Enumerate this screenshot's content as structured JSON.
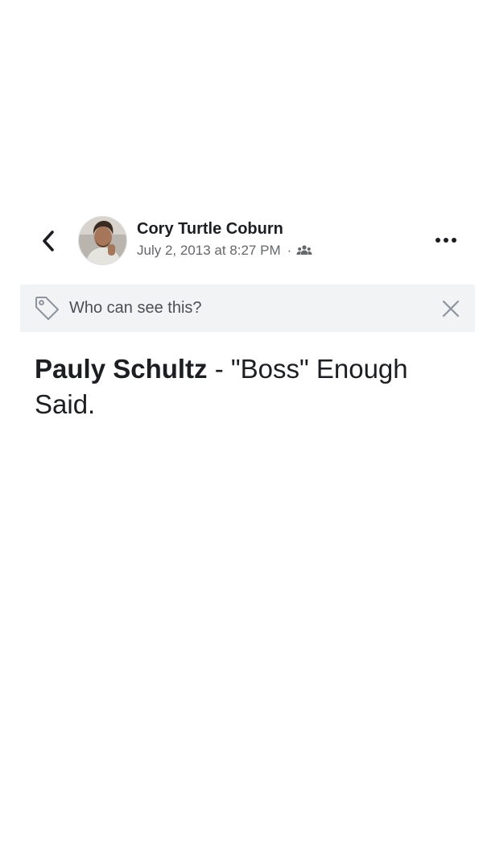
{
  "header": {
    "author_name": "Cory Turtle Coburn",
    "timestamp": "July 2, 2013 at 8:27 PM",
    "separator": "·",
    "audience_icon": "friends-icon",
    "back_icon": "chevron-left-icon",
    "more_icon": "more-dots-icon",
    "avatar_icon": "avatar-photo"
  },
  "privacy_banner": {
    "icon": "tag-icon",
    "text": "Who can see this?",
    "close_icon": "close-icon"
  },
  "post": {
    "tagged_name": "Pauly Schultz",
    "text": " - \"Boss\" Enough Said."
  },
  "colors": {
    "banner_background": "#f2f3f5",
    "primary_text": "#1c1e21",
    "secondary_text": "#65676b"
  }
}
